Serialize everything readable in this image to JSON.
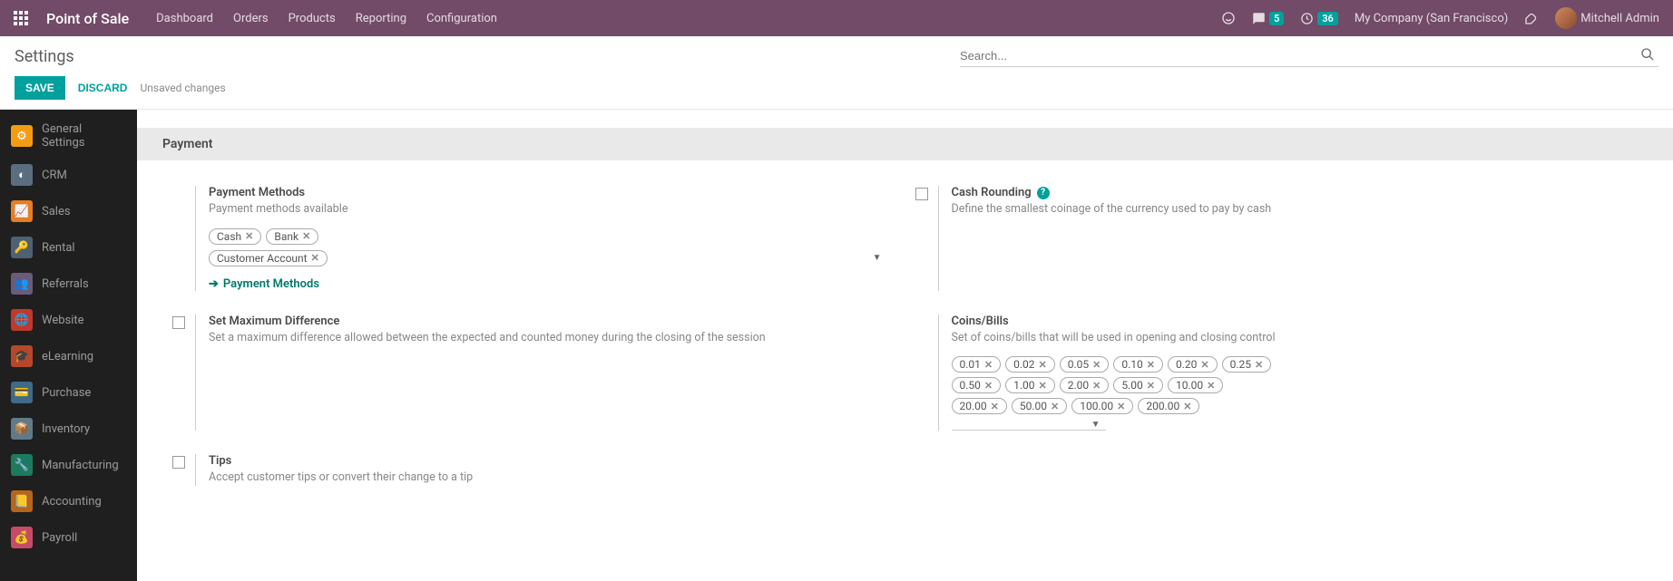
{
  "navbar": {
    "brand": "Point of Sale",
    "menu": [
      "Dashboard",
      "Orders",
      "Products",
      "Reporting",
      "Configuration"
    ],
    "messages_badge": "5",
    "activities_badge": "36",
    "company": "My Company (San Francisco)",
    "user": "Mitchell Admin"
  },
  "control": {
    "title": "Settings",
    "search_placeholder": "Search...",
    "save": "SAVE",
    "discard": "DISCARD",
    "status": "Unsaved changes"
  },
  "sidebar": {
    "items": [
      {
        "label": "General Settings",
        "color": "#f39c12"
      },
      {
        "label": "CRM",
        "color": "#5b6d80"
      },
      {
        "label": "Sales",
        "color": "#e67e22"
      },
      {
        "label": "Rental",
        "color": "#4d6173"
      },
      {
        "label": "Referrals",
        "color": "#6b5b7b"
      },
      {
        "label": "Website",
        "color": "#c0392b"
      },
      {
        "label": "eLearning",
        "color": "#b7472a"
      },
      {
        "label": "Purchase",
        "color": "#3f6a88"
      },
      {
        "label": "Inventory",
        "color": "#5f7b8a"
      },
      {
        "label": "Manufacturing",
        "color": "#1d7a5f"
      },
      {
        "label": "Accounting",
        "color": "#b5651d"
      },
      {
        "label": "Payroll",
        "color": "#c74b66"
      }
    ]
  },
  "section": {
    "title": "Payment"
  },
  "settings": {
    "payment_methods": {
      "title": "Payment Methods",
      "desc": "Payment methods available",
      "tags": [
        "Cash",
        "Bank",
        "Customer Account"
      ],
      "link": "Payment Methods"
    },
    "cash_rounding": {
      "title": "Cash Rounding",
      "desc": "Define the smallest coinage of the currency used to pay by cash"
    },
    "max_diff": {
      "title": "Set Maximum Difference",
      "desc": "Set a maximum difference allowed between the expected and counted money during the closing of the session"
    },
    "coins": {
      "title": "Coins/Bills",
      "desc": "Set of coins/bills that will be used in opening and closing control",
      "tags": [
        "0.01",
        "0.02",
        "0.05",
        "0.10",
        "0.20",
        "0.25",
        "0.50",
        "1.00",
        "2.00",
        "5.00",
        "10.00",
        "20.00",
        "50.00",
        "100.00",
        "200.00"
      ]
    },
    "tips": {
      "title": "Tips",
      "desc": "Accept customer tips or convert their change to a tip"
    }
  }
}
